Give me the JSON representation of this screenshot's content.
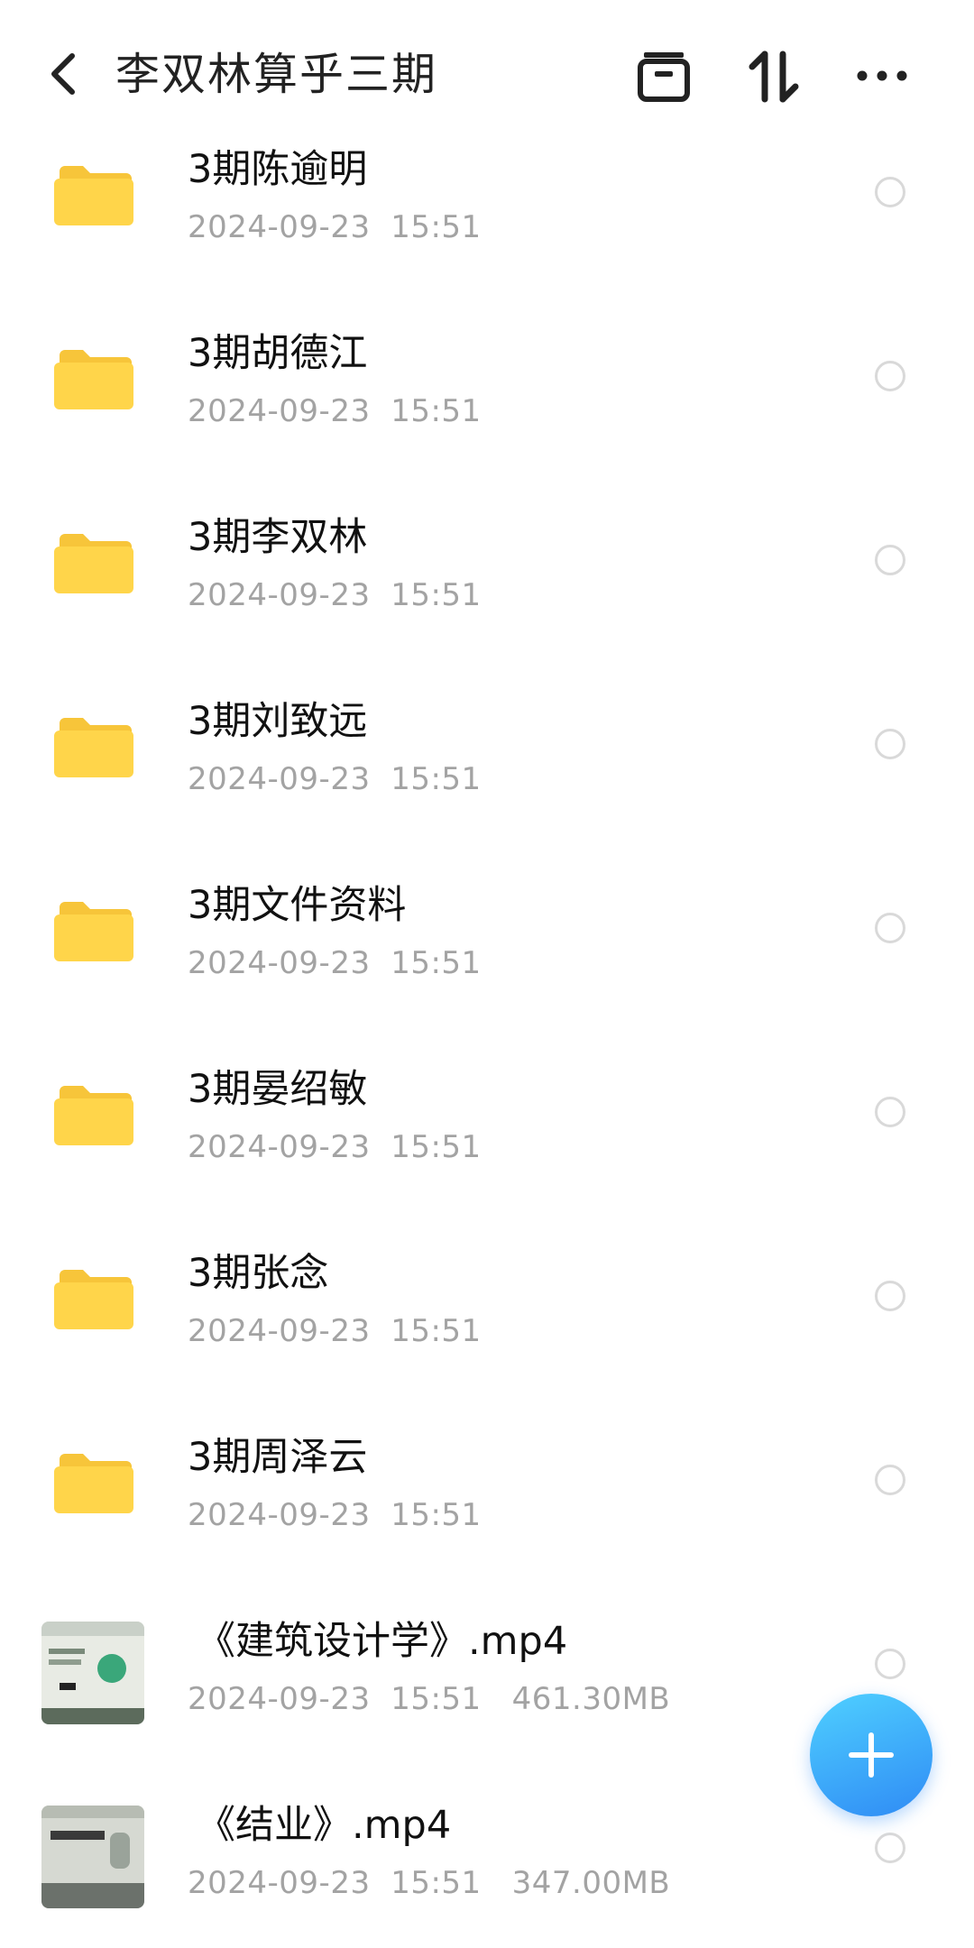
{
  "header": {
    "title": "李双林算乎三期",
    "back_icon": "chevron-left-icon",
    "actions": [
      "archive-icon",
      "sort-icon",
      "more-icon"
    ]
  },
  "items": [
    {
      "type": "folder",
      "name": "3期陈逾明",
      "meta": "2024-09-23  15:51"
    },
    {
      "type": "folder",
      "name": "3期胡德江",
      "meta": "2024-09-23  15:51"
    },
    {
      "type": "folder",
      "name": "3期李双林",
      "meta": "2024-09-23  15:51"
    },
    {
      "type": "folder",
      "name": "3期刘致远",
      "meta": "2024-09-23  15:51"
    },
    {
      "type": "folder",
      "name": "3期文件资料",
      "meta": "2024-09-23  15:51"
    },
    {
      "type": "folder",
      "name": "3期晏绍敏",
      "meta": "2024-09-23  15:51"
    },
    {
      "type": "folder",
      "name": "3期张念",
      "meta": "2024-09-23  15:51"
    },
    {
      "type": "folder",
      "name": "3期周泽云",
      "meta": "2024-09-23  15:51"
    },
    {
      "type": "video",
      "name": "《建筑设计学》.mp4",
      "meta": "2024-09-23  15:51   461.30MB"
    },
    {
      "type": "video",
      "name": "《结业》.mp4",
      "meta": "2024-09-23  15:51   347.00MB"
    }
  ],
  "fab": {
    "icon": "plus-icon"
  },
  "colors": {
    "folder": "#ffd54a",
    "fab": "#2f8bf5",
    "meta": "#a3a3a3"
  }
}
